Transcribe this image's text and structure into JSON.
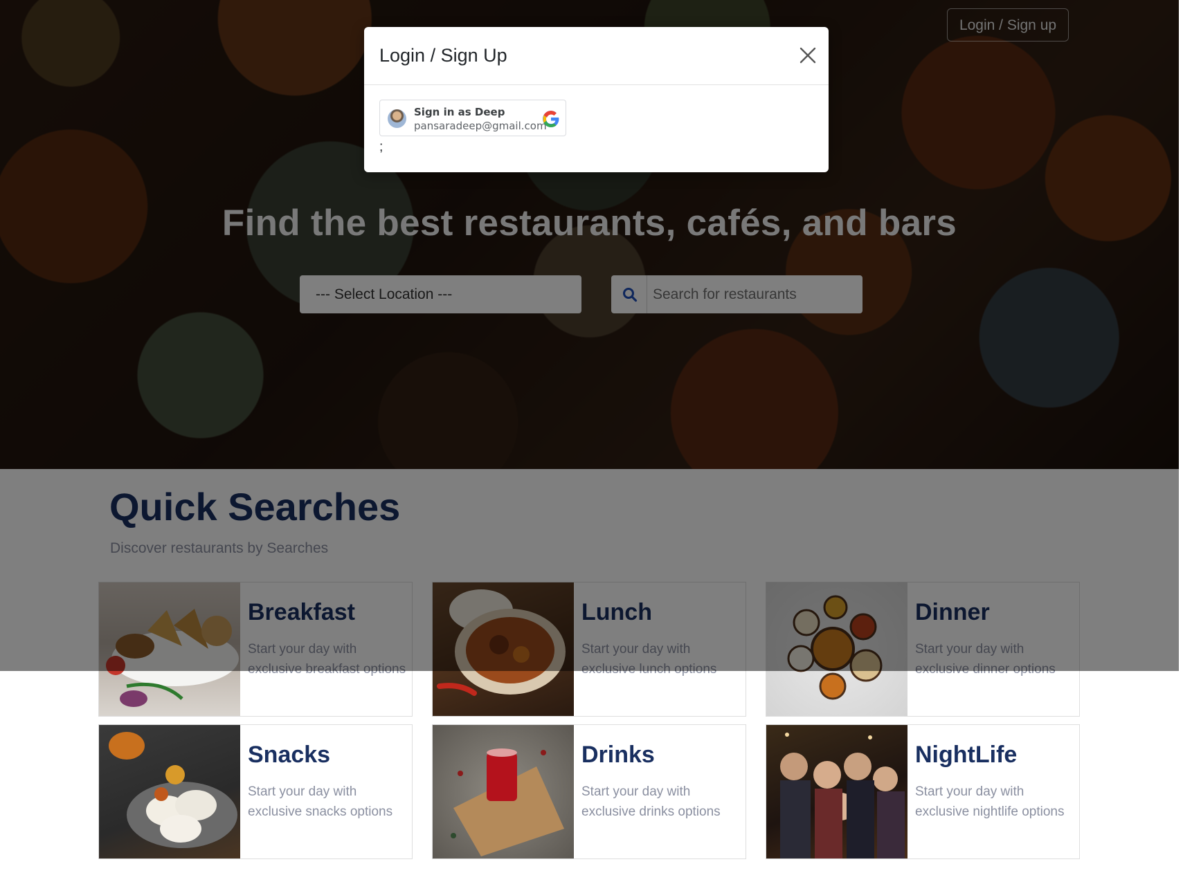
{
  "header": {
    "login_label": "Login / Sign up"
  },
  "hero": {
    "title": "Find the best restaurants, cafés, and bars",
    "location_placeholder": "--- Select Location ---",
    "search_placeholder": "Search for restaurants"
  },
  "quick_searches": {
    "title": "Quick Searches",
    "subtitle": "Discover restaurants by Searches",
    "cards": [
      {
        "title": "Breakfast",
        "description": "Start your day with exclusive breakfast options"
      },
      {
        "title": "Lunch",
        "description": "Start your day with exclusive lunch options"
      },
      {
        "title": "Dinner",
        "description": "Start your day with exclusive dinner options"
      },
      {
        "title": "Snacks",
        "description": "Start your day with exclusive snacks options"
      },
      {
        "title": "Drinks",
        "description": "Start your day with exclusive drinks options"
      },
      {
        "title": "NightLife",
        "description": "Start your day with exclusive nightlife options"
      }
    ]
  },
  "modal": {
    "title": "Login / Sign Up",
    "google_name": "Sign in as Deep",
    "google_email": "pansaradeep@gmail.com",
    "stray_text": ";"
  },
  "colors": {
    "brand_navy": "#192f60",
    "muted_text": "#8a8fa0",
    "search_icon": "#1e4fb8"
  },
  "icons": {
    "search": "search-icon",
    "close": "close-icon",
    "google": "google-logo-icon"
  }
}
